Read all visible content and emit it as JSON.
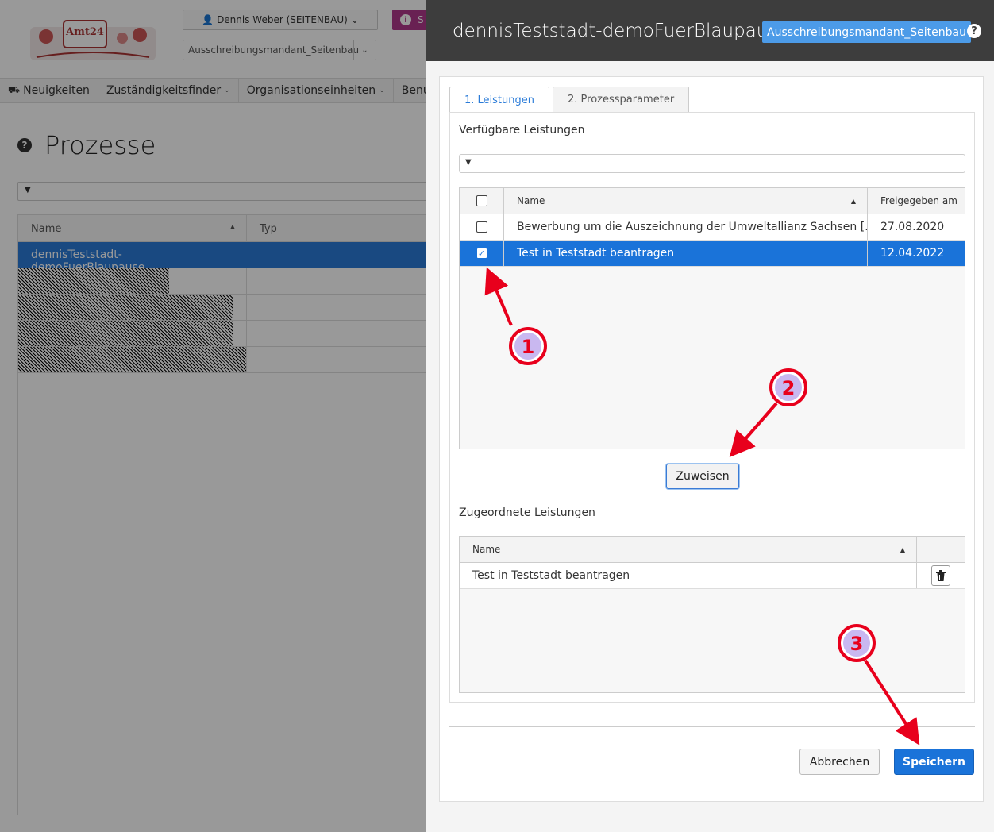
{
  "background": {
    "logo_text": "Amt24",
    "user_menu": "Dennis Weber (SEITENBAU)",
    "mandant_select": "Ausschreibungsmandant_Seitenbau",
    "info_button": "S",
    "nav": [
      "Neuigkeiten",
      "Zuständigkeitsfinder",
      "Organisationseinheiten",
      "Benu"
    ],
    "page_title": "Prozesse",
    "table": {
      "col_name": "Name",
      "col_type": "Typ",
      "selected_row": "dennisTeststadt-demoFuerBlaupause"
    }
  },
  "panel": {
    "title": "dennisTeststadt-demoFuerBlaupause",
    "mandant_badge": "Ausschreibungsmandant_Seitenbau",
    "tabs": [
      "1. Leistungen",
      "2. Prozessparameter"
    ],
    "available": {
      "label": "Verfügbare Leistungen",
      "headers": {
        "name": "Name",
        "date": "Freigegeben am"
      },
      "rows": [
        {
          "name": "Bewerbung um die Auszeichnung der Umweltallianz Sachsen [...",
          "date": "27.08.2020",
          "checked": false
        },
        {
          "name": "Test in Teststadt beantragen",
          "date": "12.04.2022",
          "checked": true
        }
      ]
    },
    "assign_button": "Zuweisen",
    "assigned": {
      "label": "Zugeordnete Leistungen",
      "header_name": "Name",
      "rows": [
        {
          "name": "Test in Teststadt beantragen"
        }
      ]
    },
    "cancel_button": "Abbrechen",
    "save_button": "Speichern"
  },
  "annotations": [
    "1",
    "2",
    "3"
  ],
  "colors": {
    "accent": "#1a73d9",
    "annotation": "#e8001c",
    "header_bg": "#3d3d3d",
    "badge": "#4c9be8"
  }
}
